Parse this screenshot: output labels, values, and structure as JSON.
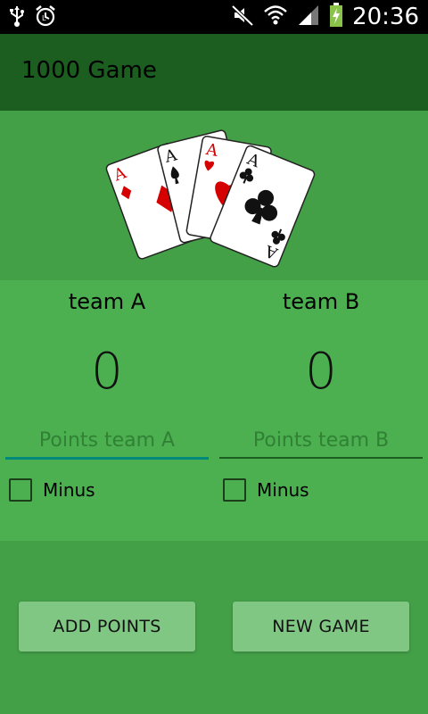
{
  "statusbar": {
    "time": "20:36",
    "icons": [
      "usb-icon",
      "alarm-icon",
      "mute-icon",
      "wifi-icon",
      "signal-icon",
      "battery-charging-icon"
    ]
  },
  "appbar": {
    "title": "1000 Game"
  },
  "hero": {
    "image": "playing-cards-aces"
  },
  "teams": [
    {
      "name": "team A",
      "score": "0",
      "placeholder": "Points team A",
      "minus_label": "Minus",
      "focused": true
    },
    {
      "name": "team B",
      "score": "0",
      "placeholder": "Points team B",
      "minus_label": "Minus",
      "focused": false
    }
  ],
  "buttons": {
    "add_points": "ADD POINTS",
    "new_game": "NEW GAME"
  },
  "colors": {
    "appbar": "#1b5e20",
    "background": "#43a047",
    "panel": "#4caf50",
    "button": "#81c784",
    "focus_underline": "#00897b"
  }
}
